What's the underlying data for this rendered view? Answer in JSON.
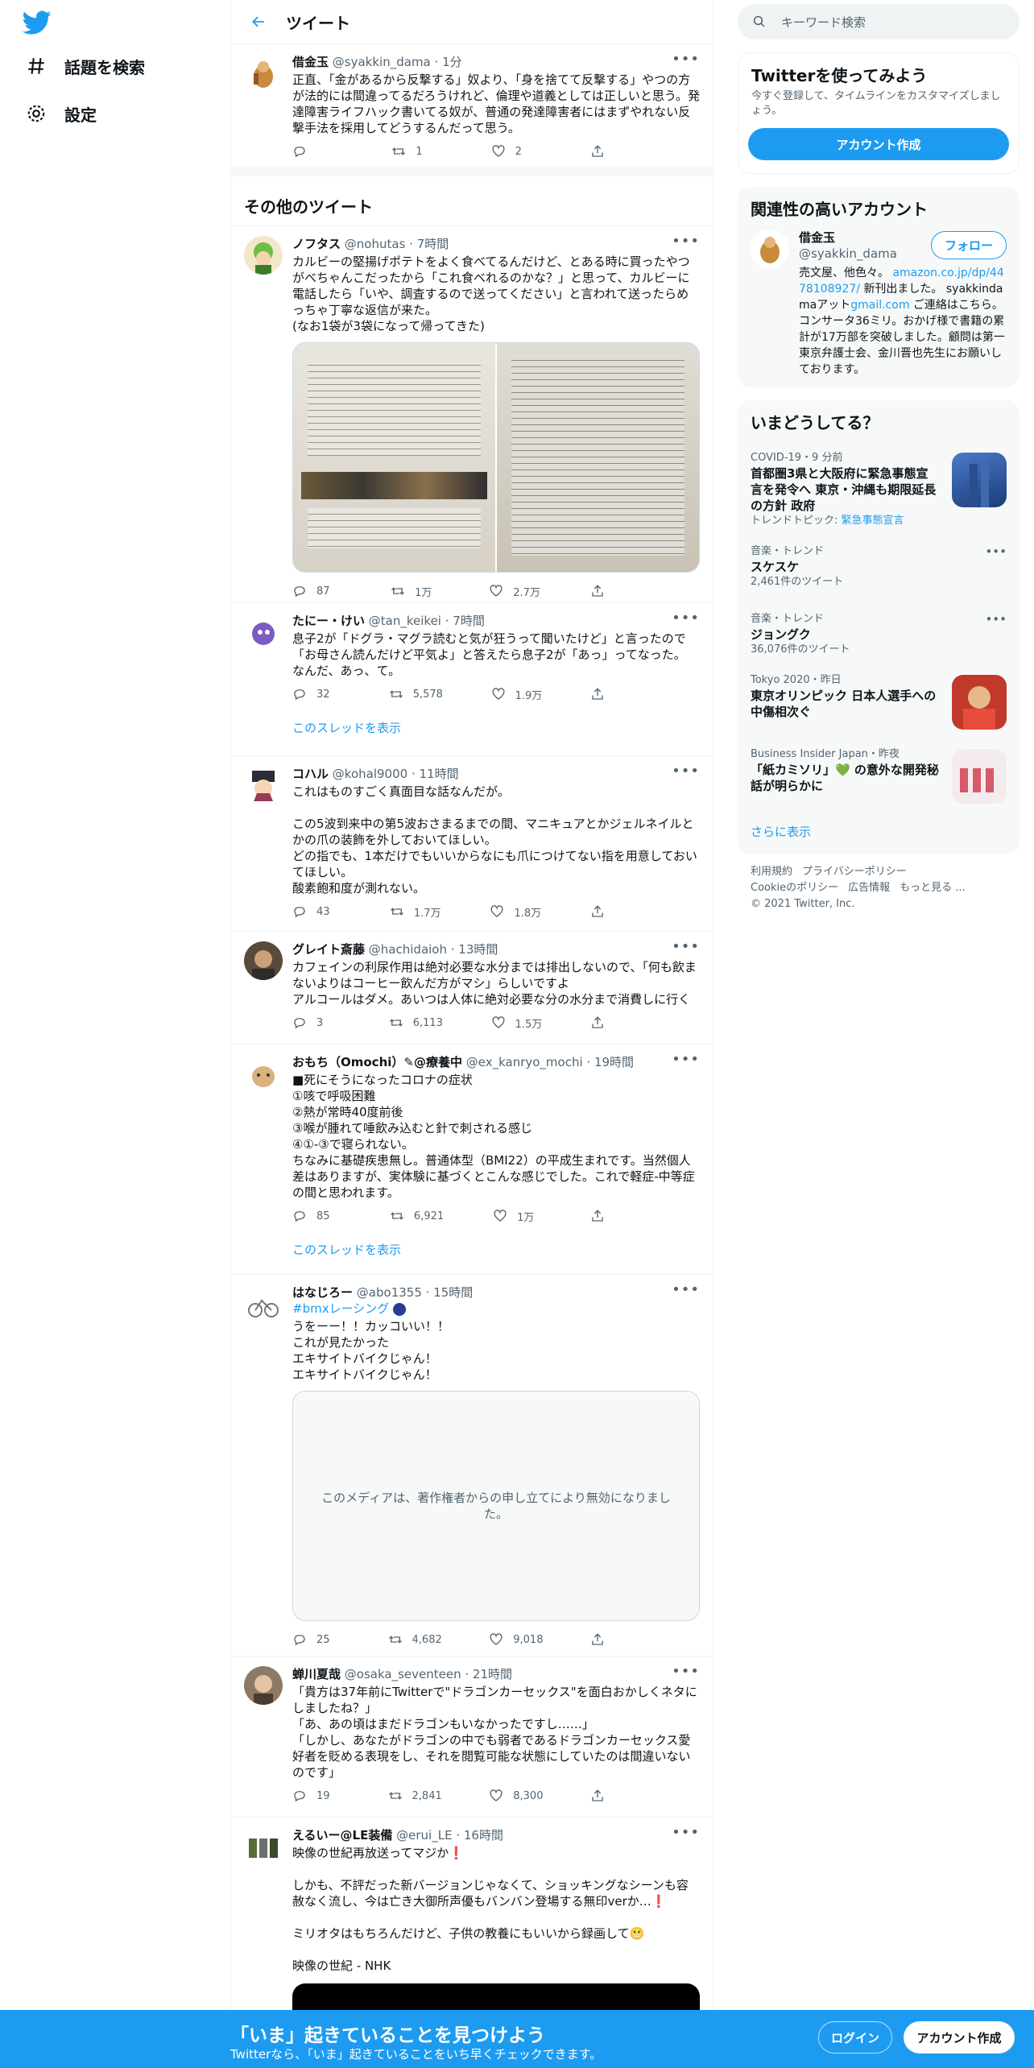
{
  "nav": {
    "explore_label": "話題を検索",
    "settings_label": "設定"
  },
  "header": {
    "title": "ツイート"
  },
  "main_tweet": {
    "name": "借金玉",
    "handle": "@syakkin_dama",
    "time": "1分",
    "text": "正直、「金があるから反撃する」奴より、「身を捨てて反撃する」やつの方が法的には間違ってるだろうけれど、倫理や道義としては正しいと思う。発達障害ライフハック書いてる奴が、普通の発達障害者にはまずやれない反撃手法を採用してどうするんだって思う。",
    "replies": "",
    "retweets": "1",
    "likes": "2"
  },
  "section_title": "その他のツイート",
  "tweets": [
    {
      "name": "ノフタス",
      "handle": "@nohutas",
      "time": "7時間",
      "text": "カルビーの堅揚げポテトをよく食べてるんだけど、とある時に買ったやつがべちゃんこだったから「これ食べれるのかな？」と思って、カルビーに電話したら「いや、調査するので送ってください」と言われて送ったらめっちゃ丁寧な返信が来た。\n(なお1袋が3袋になって帰ってきた)",
      "replies": "87",
      "retweets": "1万",
      "likes": "2.7万"
    },
    {
      "name": "たにー・けい",
      "handle": "@tan_keikei",
      "time": "7時間",
      "text": "息子2が「ドグラ・マグラ読むと気が狂うって聞いたけど」と言ったので「お母さん読んだけど平気よ」と答えたら息子2が「あっ」ってなった。\nなんだ、あっ、て。",
      "replies": "32",
      "retweets": "5,578",
      "likes": "1.9万",
      "thread": "このスレッドを表示"
    },
    {
      "name": "コハル",
      "handle": "@kohal9000",
      "time": "11時間",
      "text": "これはものすごく真面目な話なんだが。\n\nこの5波到来中の第5波おさまるまでの間、マニキュアとかジェルネイルとかの爪の装飾を外しておいてほしい。\nどの指でも、1本だけでもいいからなにも爪につけてない指を用意しておいてほしい。\n酸素飽和度が測れない。",
      "replies": "43",
      "retweets": "1.7万",
      "likes": "1.8万"
    },
    {
      "name": "グレイト斎藤",
      "handle": "@hachidaioh",
      "time": "13時間",
      "text": "カフェインの利尿作用は絶対必要な水分までは排出しないので、「何も飲まないよりはコーヒー飲んだ方がマシ」らしいですよ\nアルコールはダメ。あいつは人体に絶対必要な分の水分まで消費しに行く",
      "replies": "3",
      "retweets": "6,113",
      "likes": "1.5万"
    },
    {
      "name": "おもち（Omochi）✎@療養中",
      "handle": "@ex_kanryo_mochi",
      "time": "19時間",
      "text": "■死にそうになったコロナの症状\n①咳で呼吸困難\n②熱が常時40度前後\n③喉が腫れて唾飲み込むと針で刺される感じ\n④①-③で寝られない。\nちなみに基礎疾患無し。普通体型（BMI22）の平成生まれです。当然個人差はありますが、実体験に基づくとこんな感じでした。これで軽症-中等症の間と思われます。",
      "replies": "85",
      "retweets": "6,921",
      "likes": "1万",
      "thread": "このスレッドを表示"
    },
    {
      "name": "はなじろー",
      "handle": "@abo1355",
      "time": "15時間",
      "hashtag": "#bmxレーシング",
      "text": "うをーー！！カッコいい！！\nこれが見たかった\nエキサイトバイクじゃん！\nエキサイトバイクじゃん！",
      "media_notice": "このメディアは、著作権者からの申し立てにより無効になりました。",
      "replies": "25",
      "retweets": "4,682",
      "likes": "9,018"
    },
    {
      "name": "蝉川夏哉",
      "handle": "@osaka_seventeen",
      "time": "21時間",
      "text": "「貴方は37年前にTwitterで\"ドラゴンカーセックス\"を面白おかしくネタにしましたね？」\n「あ、あの頃はまだドラゴンもいなかったですし……」\n「しかし、あなたがドラゴンの中でも弱者であるドラゴンカーセックス愛好者を貶める表現をし、それを閲覧可能な状態にしていたのは間違いないのです」",
      "replies": "19",
      "retweets": "2,841",
      "likes": "8,300"
    },
    {
      "name": "えるいー@LE装備",
      "handle": "@erui_LE",
      "time": "16時間",
      "text": "映像の世紀再放送ってマジか❗\n\nしかも、不評だった新バージョンじゃなくて、ショッキングなシーンも容赦なく流し、今は亡き大御所声優もバンバン登場する無印verか…❗\n\nミリオタはもちろんだけど、子供の教養にもいいから録画して😬\n\n映像の世紀 - NHK"
    }
  ],
  "search": {
    "placeholder": "キーワード検索"
  },
  "signup_box": {
    "title": "Twitterを使ってみよう",
    "desc": "今すぐ登録して、タイムラインをカスタマイズしましょう。",
    "button": "アカウント作成"
  },
  "related": {
    "title": "関連性の高いアカウント",
    "name": "借金玉",
    "handle": "@syakkin_dama",
    "follow": "フォロー",
    "bio_1": "売文屋、他色々。",
    "bio_link1": "amazon.co.jp/dp/4478108927/",
    "bio_2": "新刊出ました。 syakkindamaアット",
    "bio_link2": "gmail.com",
    "bio_3": "ご連絡はこちら。 コンサータ36ミリ。おかげ様で書籍の累計が17万部を突破しました。顧問は第一東京弁護士会、金川晋也先生にお願いしております。"
  },
  "trends": {
    "title": "いまどうしてる？",
    "items": [
      {
        "cat": "COVID-19・9 分前",
        "ttl": "首都圏3県と大阪府に緊急事態宣言を発令へ 東京・沖縄も期限延長の方針 政府",
        "sub_prefix": "トレンドトピック: ",
        "sub_link": "緊急事態宣言"
      },
      {
        "cat": "音楽・トレンド",
        "ttl": "スケスケ",
        "sub": "2,461件のツイート"
      },
      {
        "cat": "音楽・トレンド",
        "ttl": "ジョングク",
        "sub": "36,076件のツイート"
      },
      {
        "cat": "Tokyo 2020・昨日",
        "ttl": "東京オリンピック 日本人選手への中傷相次ぐ"
      },
      {
        "cat": "Business Insider Japan・昨夜",
        "ttl": "「紙カミソリ」💚 の意外な開発秘話が明らかに"
      }
    ],
    "more": "さらに表示"
  },
  "footer": {
    "items": [
      "利用規約",
      "プライバシーポリシー",
      "Cookieのポリシー",
      "広告情報",
      "もっと見る ..."
    ],
    "copyright": "© 2021 Twitter, Inc."
  },
  "bottom_bar": {
    "title": "「いま」起きていることを見つけよう",
    "subtitle": "Twitterなら、「いま」起きていることをいち早くチェックできます。",
    "login": "ログイン",
    "signup": "アカウント作成"
  }
}
